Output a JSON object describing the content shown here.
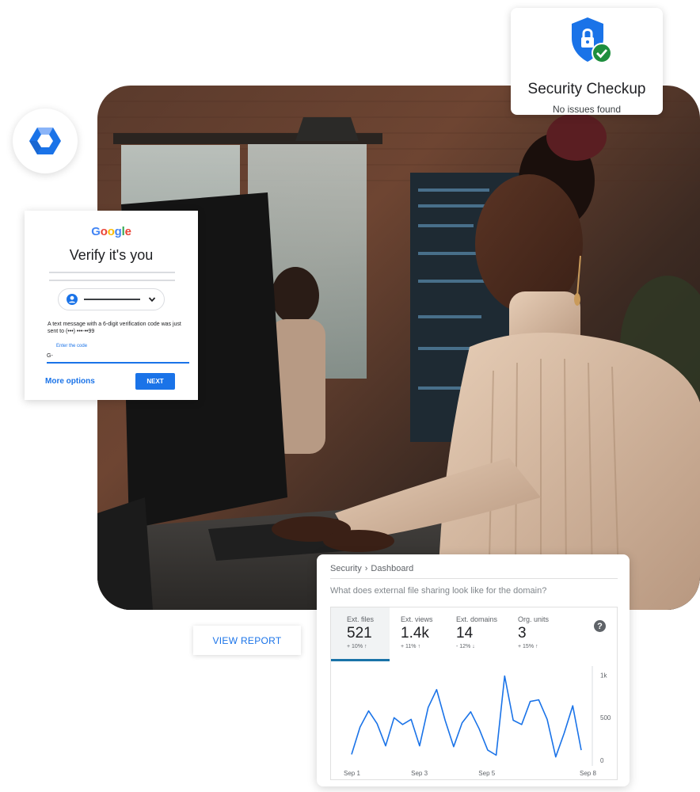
{
  "security_checkup": {
    "title": "Security Checkup",
    "status": "No issues found",
    "icon": "shield-lock-check-icon",
    "colors": {
      "shield": "#1a73e8",
      "check": "#1e8e3e"
    }
  },
  "logo_badge": {
    "icon": "google-workspace-admin-icon"
  },
  "verify_card": {
    "brand": [
      "G",
      "o",
      "o",
      "g",
      "l",
      "e"
    ],
    "brand_colors": [
      "#4285f4",
      "#ea4335",
      "#fbbc05",
      "#4285f4",
      "#34a853",
      "#ea4335"
    ],
    "heading": "Verify it's you",
    "message": "A text message with a 6-digit verification code was just sent to (•••) •••-••99",
    "code_label": "Enter the code",
    "code_value": "G-",
    "more_options": "More options",
    "next": "NEXT"
  },
  "view_report": {
    "label": "VIEW REPORT"
  },
  "dashboard": {
    "breadcrumb": {
      "section": "Security",
      "separator": "›",
      "page": "Dashboard"
    },
    "question": "What does external file sharing look like for the domain?",
    "help_icon": "?",
    "metrics": [
      {
        "label": "Ext. files",
        "value": "521",
        "change": "+ 10% ↑",
        "active": true
      },
      {
        "label": "Ext. views",
        "value": "1.4k",
        "change": "+ 11% ↑",
        "active": false
      },
      {
        "label": "Ext. domains",
        "value": "14",
        "change": "- 12% ↓",
        "active": false
      },
      {
        "label": "Org. units",
        "value": "3",
        "change": "+ 15% ↑",
        "active": false
      }
    ]
  },
  "chart_data": {
    "type": "line",
    "title": "",
    "xlabel": "",
    "ylabel": "",
    "x_ticks": [
      "Sep 1",
      "Sep 3",
      "Sep 5",
      "Sep 8"
    ],
    "y_ticks": [
      "0",
      "500",
      "1k"
    ],
    "ylim": [
      0,
      1050
    ],
    "grid": false,
    "series": [
      {
        "color": "#1a73e8",
        "values": [
          70,
          390,
          580,
          430,
          170,
          500,
          420,
          480,
          170,
          620,
          830,
          470,
          160,
          440,
          570,
          370,
          120,
          60,
          990,
          470,
          420,
          690,
          710,
          480,
          40,
          320,
          640,
          120
        ]
      }
    ]
  }
}
